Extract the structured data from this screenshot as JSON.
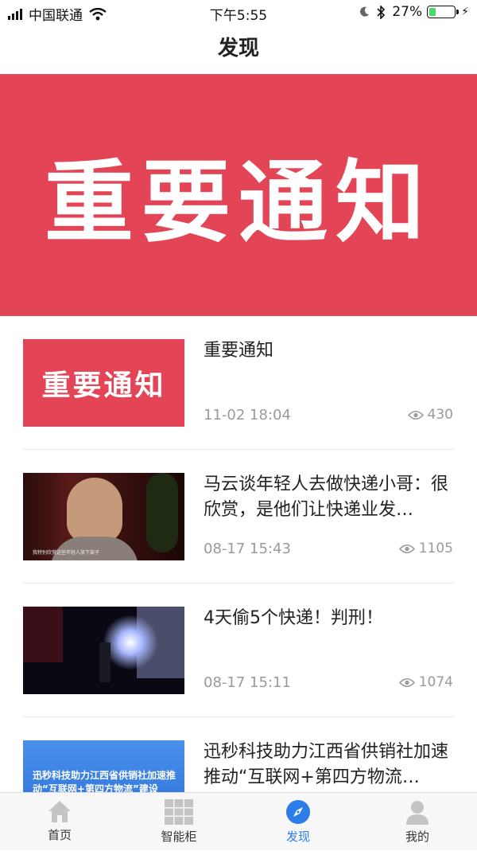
{
  "status_bar": {
    "carrier": "中国联通",
    "time": "下午5:55",
    "battery": "27%",
    "battery_level": 0.27
  },
  "nav": {
    "title": "发现"
  },
  "banner": {
    "text": "重要通知",
    "color": "#e34456"
  },
  "news": [
    {
      "title": "重要通知",
      "date": "11-02 18:04",
      "views": "430",
      "thumb_text": "重要通知"
    },
    {
      "title": "马云谈年轻人去做快递小哥：很欣赏，是他们让快递业发…",
      "date": "08-17 15:43",
      "views": "1105",
      "thumb_caption": "我特别欣赏这些年轻人放下架子"
    },
    {
      "title": "4天偷5个快递！判刑！",
      "date": "08-17 15:11",
      "views": "1074"
    },
    {
      "title": "迅秒科技助力江西省供销社加速推动“互联网+第四方物流…",
      "date": "",
      "views": "",
      "thumb_text": "迅秒科技助力江西省供销社加速推动“互联网+第四方物流”建设"
    }
  ],
  "tabs": [
    {
      "label": "首页",
      "icon": "home-icon"
    },
    {
      "label": "智能柜",
      "icon": "grid-icon"
    },
    {
      "label": "发现",
      "icon": "compass-icon",
      "active": true
    },
    {
      "label": "我的",
      "icon": "user-icon"
    }
  ],
  "colors": {
    "accent": "#2d7de8",
    "battery_fill": "#4cd964"
  }
}
